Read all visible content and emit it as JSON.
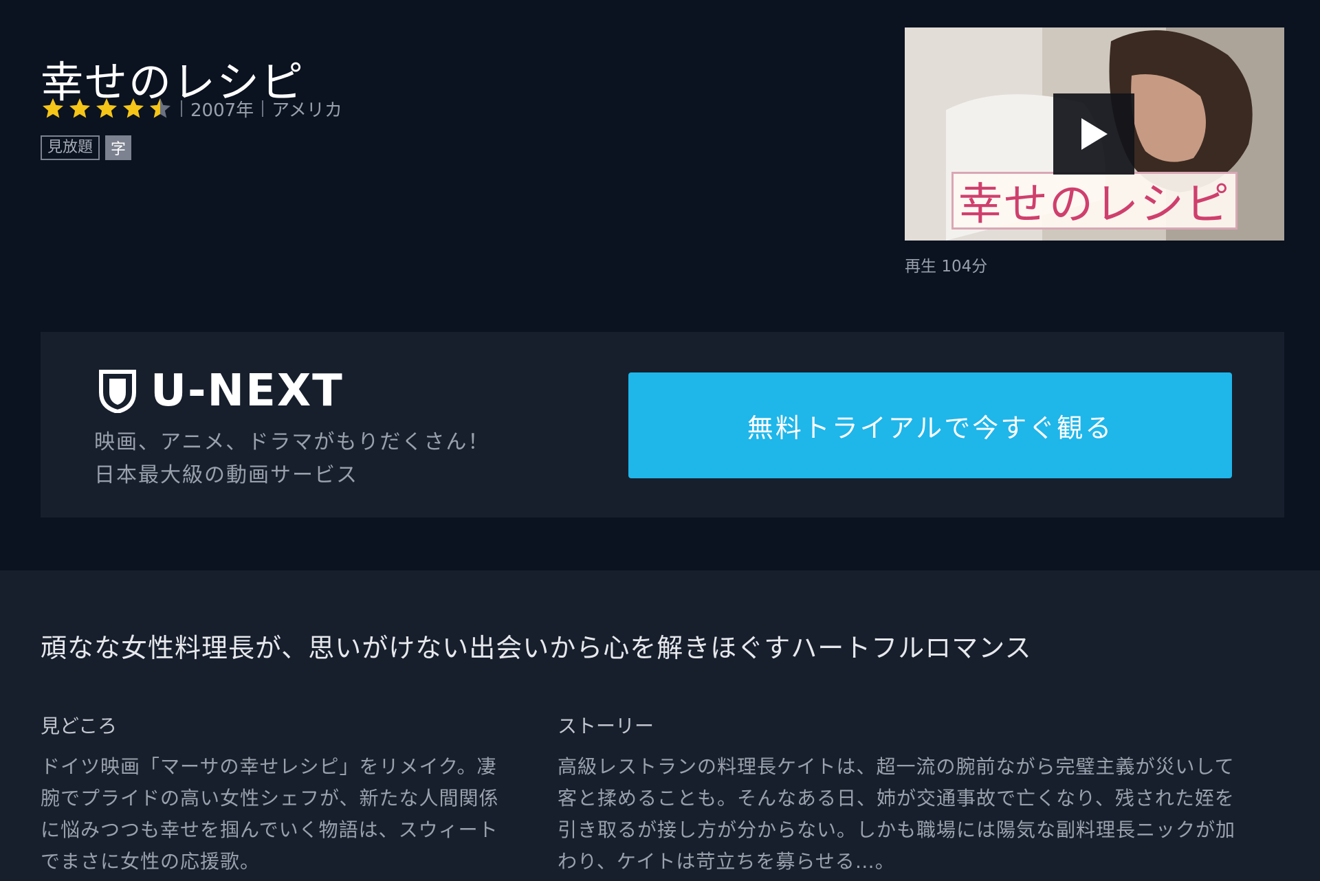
{
  "title": "幸せのレシピ",
  "rating": {
    "value": 4.5,
    "max": 5,
    "star_color": "#f5c518",
    "empty_color": "#6b7281"
  },
  "meta": {
    "year": "2007年",
    "country": "アメリカ"
  },
  "badges": {
    "unlimited": "見放題",
    "subtitle": "字"
  },
  "player": {
    "thumbnail_title": "幸せのレシピ",
    "play_label": "再生",
    "duration": "104分"
  },
  "promo": {
    "brand": "U-NEXT",
    "line1": "映画、アニメ、ドラマがもりだくさん！",
    "line2": "日本最大級の動画サービス",
    "cta_label": "無料トライアルで今すぐ観る",
    "cta_color": "#1fb6ea"
  },
  "catchphrase": "頑なな女性料理長が、思いがけない出会いから心を解きほぐすハートフルロマンス",
  "highlights": {
    "heading": "見どころ",
    "lines": [
      "ドイツ映画「マーサの幸せレシピ」をリメイク。凄",
      "腕でプライドの高い女性シェフが、新たな人間関係",
      "に悩みつつも幸せを掴んでいく物語は、スウィート",
      "でまさに女性の応援歌。"
    ]
  },
  "story": {
    "heading": "ストーリー",
    "lines": [
      "高級レストランの料理長ケイトは、超一流の腕前ながら完璧主義が災いして",
      "客と揉めることも。そんなある日、姉が交通事故で亡くなり、残された姪を",
      "引き取るが接し方が分からない。しかも職場には陽気な副料理長ニックが加",
      "わり、ケイトは苛立ちを募らせる…。"
    ]
  },
  "colors": {
    "background": "#0b1220",
    "panel": "#171f2d",
    "muted_text": "#9aa1ad"
  }
}
